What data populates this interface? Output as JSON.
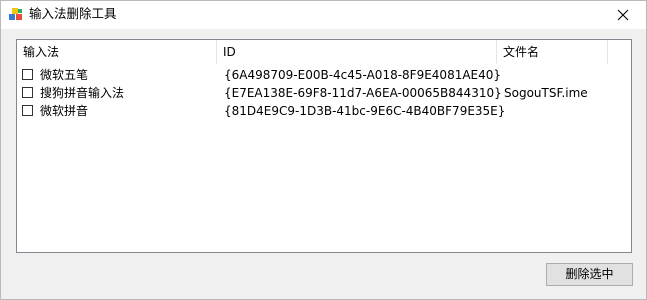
{
  "window": {
    "title": "输入法删除工具",
    "app_icon": "colorful-blocks-icon",
    "close_icon": "close-icon"
  },
  "list": {
    "columns": [
      "输入法",
      "ID",
      "文件名"
    ],
    "rows": [
      {
        "name": "微软五笔",
        "id": "{6A498709-E00B-4c45-A018-8F9E4081AE40}",
        "file": "",
        "checked": false
      },
      {
        "name": "搜狗拼音输入法",
        "id": "{E7EA138E-69F8-11d7-A6EA-00065B844310}",
        "file": "SogouTSF.ime",
        "checked": false
      },
      {
        "name": "微软拼音",
        "id": "{81D4E9C9-1D3B-41bc-9E6C-4B40BF79E35E}",
        "file": "",
        "checked": false
      }
    ]
  },
  "actions": {
    "delete_label": "删除选中"
  }
}
